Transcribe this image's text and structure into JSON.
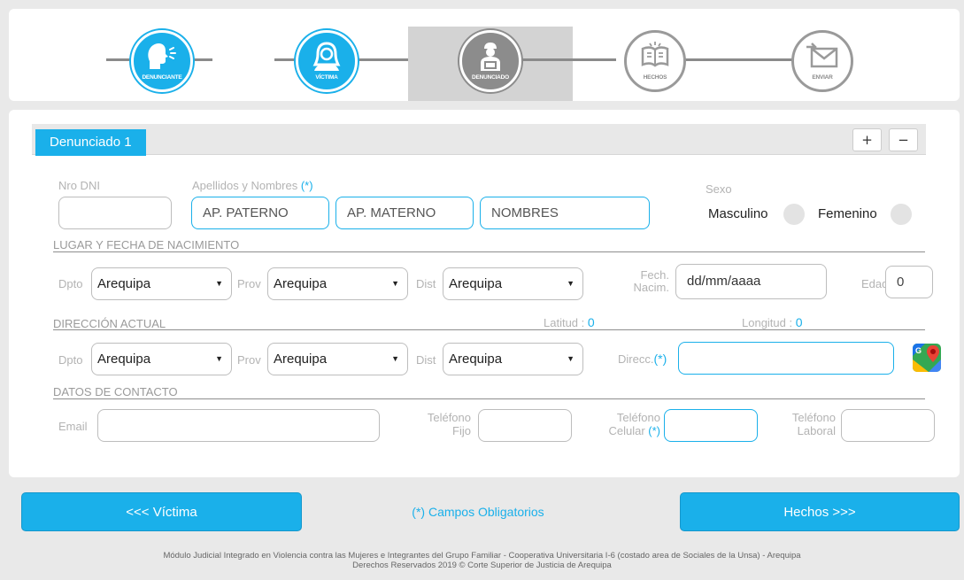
{
  "stepper": {
    "steps": [
      {
        "caption": "DENUNCIANTE",
        "icon": "speaking-person-icon",
        "state": "active"
      },
      {
        "caption": "VÍCTIMA",
        "icon": "woman-icon",
        "state": "active"
      },
      {
        "caption": "DENUNCIADO",
        "icon": "denounced-person-icon",
        "state": "current"
      },
      {
        "caption": "HECHOS",
        "icon": "book-icon",
        "state": "pending"
      },
      {
        "caption": "ENVIAR",
        "icon": "envelope-icon",
        "state": "pending"
      }
    ]
  },
  "tabs": {
    "active_label": "Denunciado 1",
    "add_label": "+",
    "remove_label": "−"
  },
  "person": {
    "dni_label": "Nro DNI",
    "dni_value": "",
    "names_label": "Apellidos y Nombres",
    "required_mark": "(*)",
    "ap_paterno_placeholder": "AP. PATERNO",
    "ap_materno_placeholder": "AP. MATERNO",
    "nombres_placeholder": "NOMBRES",
    "sex_label": "Sexo",
    "sex_male": "Masculino",
    "sex_female": "Femenino"
  },
  "birth": {
    "section_title": "LUGAR Y FECHA DE NACIMIENTO",
    "dpto_label": "Dpto",
    "dpto_value": "Arequipa",
    "prov_label": "Prov",
    "prov_value": "Arequipa",
    "dist_label": "Dist",
    "dist_value": "Arequipa",
    "date_label_1": "Fech.",
    "date_label_2": "Nacim.",
    "date_placeholder": "dd/mm/aaaa",
    "age_label": "Edad",
    "age_value": "0"
  },
  "address": {
    "section_title": "DIRECCIÓN ACTUAL",
    "lat_label": "Latitud :",
    "lat_value": "0",
    "lng_label": "Longitud :",
    "lng_value": "0",
    "dpto_label": "Dpto",
    "dpto_value": "Arequipa",
    "prov_label": "Prov",
    "prov_value": "Arequipa",
    "dist_label": "Dist",
    "dist_value": "Arequipa",
    "direcc_label": "Direcc.",
    "direcc_value": "",
    "maps_icon": "google-maps-icon"
  },
  "contact": {
    "section_title": "DATOS DE CONTACTO",
    "email_label": "Email",
    "fijo_label_1": "Teléfono",
    "fijo_label_2": "Fijo",
    "celular_label_1": "Teléfono",
    "celular_label_2": "Celular",
    "laboral_label_1": "Teléfono",
    "laboral_label_2": "Laboral"
  },
  "footer_nav": {
    "prev_label": "<<< Víctima",
    "next_label": "Hechos >>>",
    "required_note": "(*) Campos Obligatorios"
  },
  "footer": {
    "line1": "Módulo Judicial Integrado en Violencia contra las Mujeres e Integrantes del Grupo Familiar - Cooperativa Universitaria I-6 (costado area de Sociales de la Unsa) - Arequipa",
    "line2": "Derechos Reservados 2019 © Corte Superior de Justicia de Arequipa"
  },
  "colors": {
    "accent": "#1ab0ea",
    "current_step": "#8c8c8c",
    "pending_step": "#9a9a9a",
    "label_grey": "#b3b3b3"
  }
}
